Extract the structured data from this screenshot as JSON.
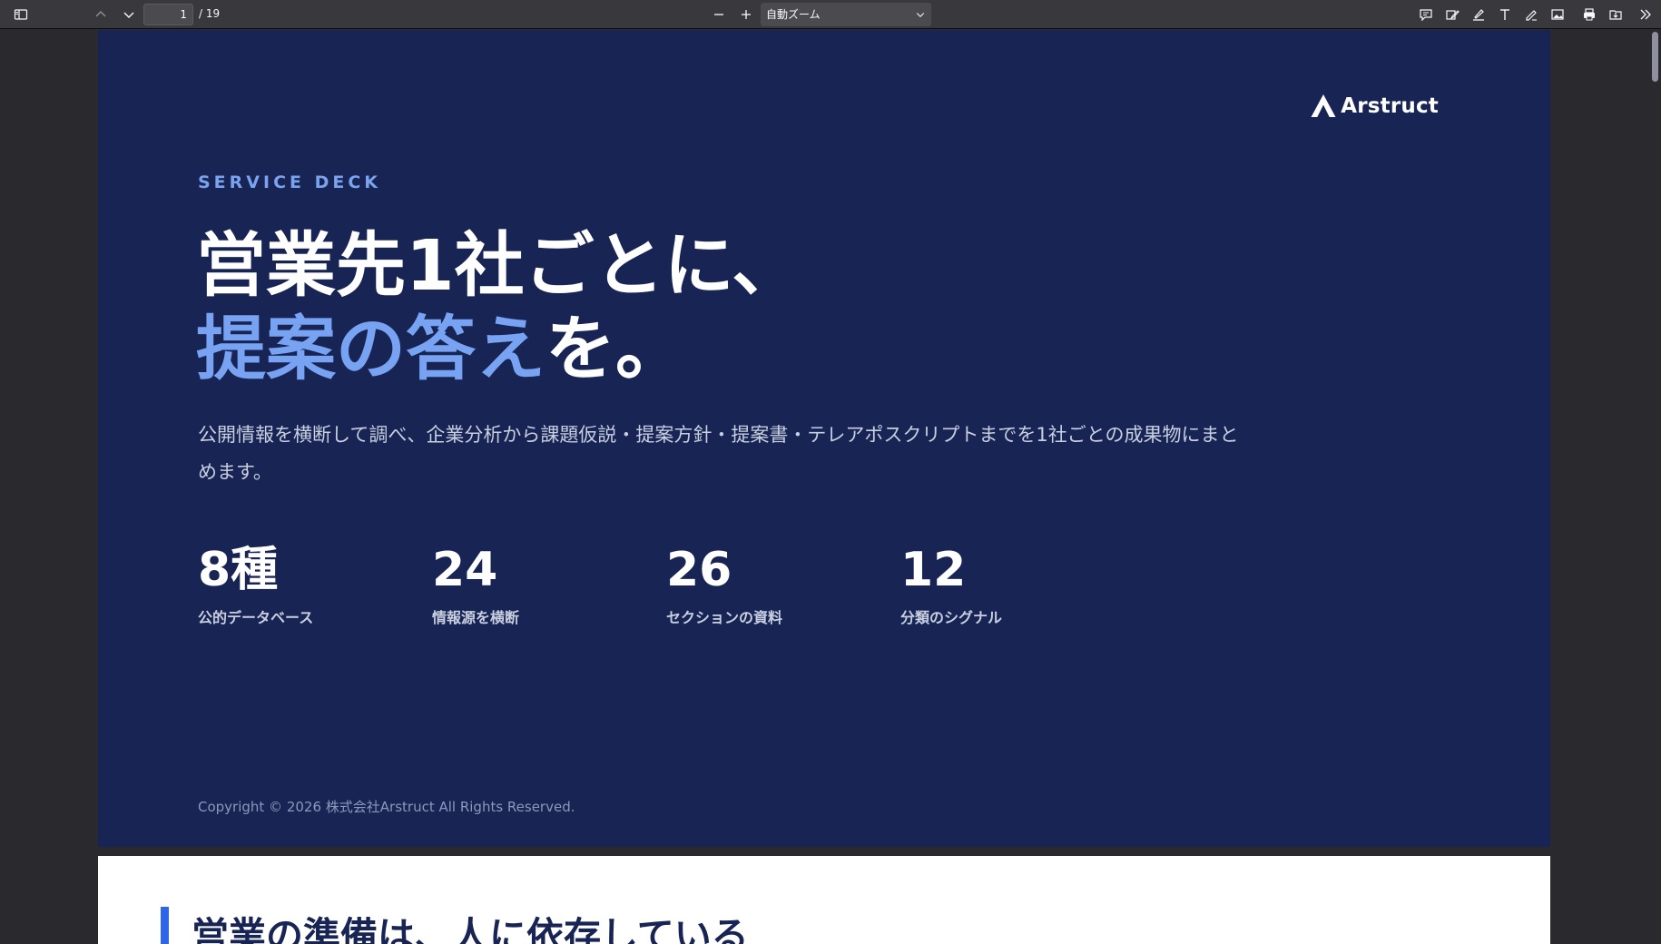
{
  "toolbar": {
    "page_current": "1",
    "page_total": "/ 19",
    "zoom": "自動ズーム",
    "icons": [
      "sidebar-toggle-icon",
      "chevron-up-icon",
      "chevron-down-icon",
      "minus-icon",
      "plus-icon",
      "comment-icon",
      "signature-icon",
      "highlight-icon",
      "text-icon",
      "draw-icon",
      "image-icon",
      "print-icon",
      "save-icon",
      "double-chevron-right-icon"
    ]
  },
  "slide1": {
    "logo": "Arstruct",
    "eyebrow": "SERVICE DECK",
    "headline_line1": "営業先1社ごとに、",
    "headline_accent": "提案の答え",
    "headline_rest": "を。",
    "description": "公開情報を横断して調べ、企業分析から課題仮説・提案方針・提案書・テレアポスクリプトまでを1社ごとの成果物にまとめます。",
    "stats": [
      {
        "value": "8種",
        "label": "公的データベース"
      },
      {
        "value": "24",
        "label": "情報源を横断"
      },
      {
        "value": "26",
        "label": "セクションの資料"
      },
      {
        "value": "12",
        "label": "分類のシグナル"
      }
    ],
    "copyright": "Copyright © 2026 株式会社Arstruct All Rights Reserved."
  },
  "slide2": {
    "title": "営業の準備は、人に依存している"
  },
  "colors": {
    "slide_bg": "#172454",
    "accent": "#78a2f2",
    "bar_accent": "#2f65e8"
  }
}
